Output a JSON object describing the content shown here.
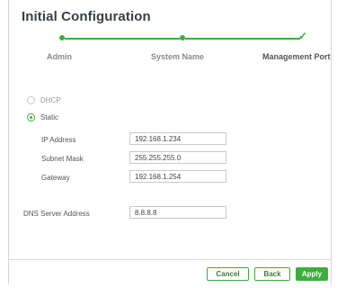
{
  "dialog": {
    "title": "Initial Configuration"
  },
  "stepper": {
    "steps": [
      {
        "label": "Admin"
      },
      {
        "label": "System Name"
      },
      {
        "label": "Management Port"
      }
    ],
    "check_glyph": "✓"
  },
  "addressing": {
    "options": [
      {
        "label": "DHCP",
        "selected": false
      },
      {
        "label": "Static",
        "selected": true
      }
    ]
  },
  "fields": {
    "ip": {
      "label": "IP Address",
      "value": "192.168.1.234"
    },
    "mask": {
      "label": "Subnet Mask",
      "value": "255.255.255.0"
    },
    "gateway": {
      "label": "Gateway",
      "value": "192.168.1.254"
    },
    "dns": {
      "label": "DNS Server Address",
      "value": "8.8.8.8"
    }
  },
  "buttons": {
    "cancel": "Cancel",
    "back": "Back",
    "apply": "Apply"
  },
  "colors": {
    "accent": "#3cae3b"
  }
}
